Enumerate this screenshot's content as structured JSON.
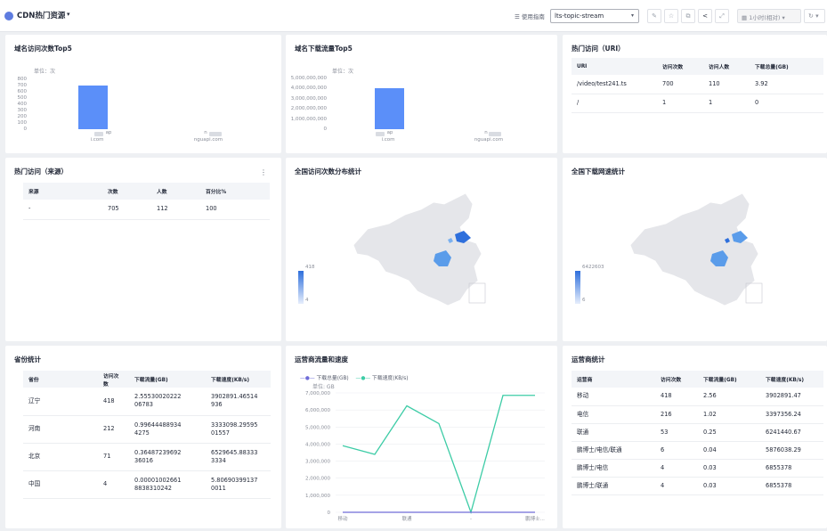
{
  "header": {
    "title": "CDN热门资源",
    "guide": "使用指南",
    "stream_select": "lts-topic-stream",
    "time_range": "1小时(相对)"
  },
  "colors": {
    "bar": "#5b8ff9",
    "line_traffic": "#6f6cd8",
    "line_speed": "#3dcca6",
    "map_dark": "#2e6fdc",
    "map_mid": "#5a9cea"
  },
  "domain_visits": {
    "title": "域名访问次数Top5",
    "unit": "单位：次",
    "chart_data": {
      "type": "bar",
      "categories": [
        "l...ap i.com",
        "n... nguapi.com"
      ],
      "values": [
        700,
        0
      ],
      "yticks": [
        "800",
        "700",
        "600",
        "500",
        "400",
        "300",
        "200",
        "100",
        "0"
      ],
      "ylim": [
        0,
        800
      ]
    },
    "cat_labels": [
      {
        "top": "ap",
        "bottom": "i.com"
      },
      {
        "top": "n",
        "bottom": "nguapi.com"
      }
    ]
  },
  "domain_traffic": {
    "title": "域名下载流量Top5",
    "unit": "单位：次",
    "chart_data": {
      "type": "bar",
      "categories": [
        "l...ap i.com",
        "n... nguapi.com"
      ],
      "values": [
        4000000000,
        0
      ],
      "yticks": [
        "5,000,000,000",
        "4,000,000,000",
        "3,000,000,000",
        "2,000,000,000",
        "1,000,000,000",
        "0"
      ],
      "ylim": [
        0,
        5000000000
      ]
    },
    "cat_labels": [
      {
        "top": "ap",
        "bottom": "i.com"
      },
      {
        "top": "n",
        "bottom": "nguapi.com"
      }
    ]
  },
  "hot_uri": {
    "title": "热门访问（URI）",
    "columns": [
      "URI",
      "访问次数",
      "访问人数",
      "下载总量(GB)"
    ],
    "rows": [
      [
        "/video/test241.ts",
        "700",
        "110",
        "3.92"
      ],
      [
        "/",
        "1",
        "1",
        "0"
      ]
    ]
  },
  "hot_source": {
    "title": "热门访问（来源）",
    "columns": [
      "来源",
      "次数",
      "人数",
      "百分比%"
    ],
    "rows": [
      [
        "-",
        "705",
        "112",
        "100"
      ]
    ]
  },
  "visit_map": {
    "title": "全国访问次数分布统计",
    "legend_max": "418",
    "legend_min": "4"
  },
  "speed_map": {
    "title": "全国下载网速统计",
    "legend_max": "6422603",
    "legend_min": "6"
  },
  "province": {
    "title": "省份统计",
    "columns": [
      "省份",
      "访问次数",
      "下载流量(GB)",
      "下载速度(KB/s)"
    ],
    "rows": [
      [
        "辽宁",
        "418",
        [
          "2.55530020222",
          "06783"
        ],
        [
          "3902891.46514",
          "936"
        ]
      ],
      [
        "河南",
        "212",
        [
          "0.99644488934",
          "4275"
        ],
        [
          "3333098.29595",
          "01557"
        ]
      ],
      [
        "北京",
        "71",
        [
          "0.36487239692",
          "36016"
        ],
        [
          "6529645.88333",
          "3334"
        ]
      ],
      [
        "中国",
        "4",
        [
          "0.00001002661",
          "8838310242"
        ],
        [
          "5.80690399137",
          "0011"
        ]
      ]
    ]
  },
  "isp_chart": {
    "title": "运营商流量和速度",
    "legend": [
      "下载总量(GB)",
      "下载速度(KB/s)"
    ],
    "unit": "单位: GB",
    "chart_data": {
      "type": "line",
      "categories": [
        "移动",
        "电信",
        "联通",
        "-",
        "鹏博士/电信",
        "鹏博士/联通"
      ],
      "xticks": [
        "移动",
        "联通",
        "-",
        "鹏博士..."
      ],
      "series": [
        {
          "name": "下载总量(GB)",
          "values": [
            2.56,
            1.02,
            0.25,
            0.04,
            0.03,
            0.03
          ]
        },
        {
          "name": "下载速度(KB/s)",
          "values": [
            3902891.47,
            3397356.24,
            6241440.67,
            5200000,
            0,
            6855378,
            6855378
          ]
        }
      ],
      "yticks": [
        "7,000,000",
        "6,000,000",
        "5,000,000",
        "4,000,000",
        "3,000,000",
        "2,000,000",
        "1,000,000",
        "0"
      ],
      "ylim": [
        0,
        7000000
      ]
    }
  },
  "isp_table": {
    "title": "运营商统计",
    "columns": [
      "运营商",
      "访问次数",
      "下载流量(GB)",
      "下载速度(KB/s)"
    ],
    "rows": [
      [
        "移动",
        "418",
        "2.56",
        "3902891.47"
      ],
      [
        "电信",
        "216",
        "1.02",
        "3397356.24"
      ],
      [
        "联通",
        "53",
        "0.25",
        "6241440.67"
      ],
      [
        "鹏博士/电信/联通",
        "6",
        "0.04",
        "5876038.29"
      ],
      [
        "鹏博士/电信",
        "4",
        "0.03",
        "6855378"
      ],
      [
        "鹏博士/联通",
        "4",
        "0.03",
        "6855378"
      ]
    ]
  }
}
